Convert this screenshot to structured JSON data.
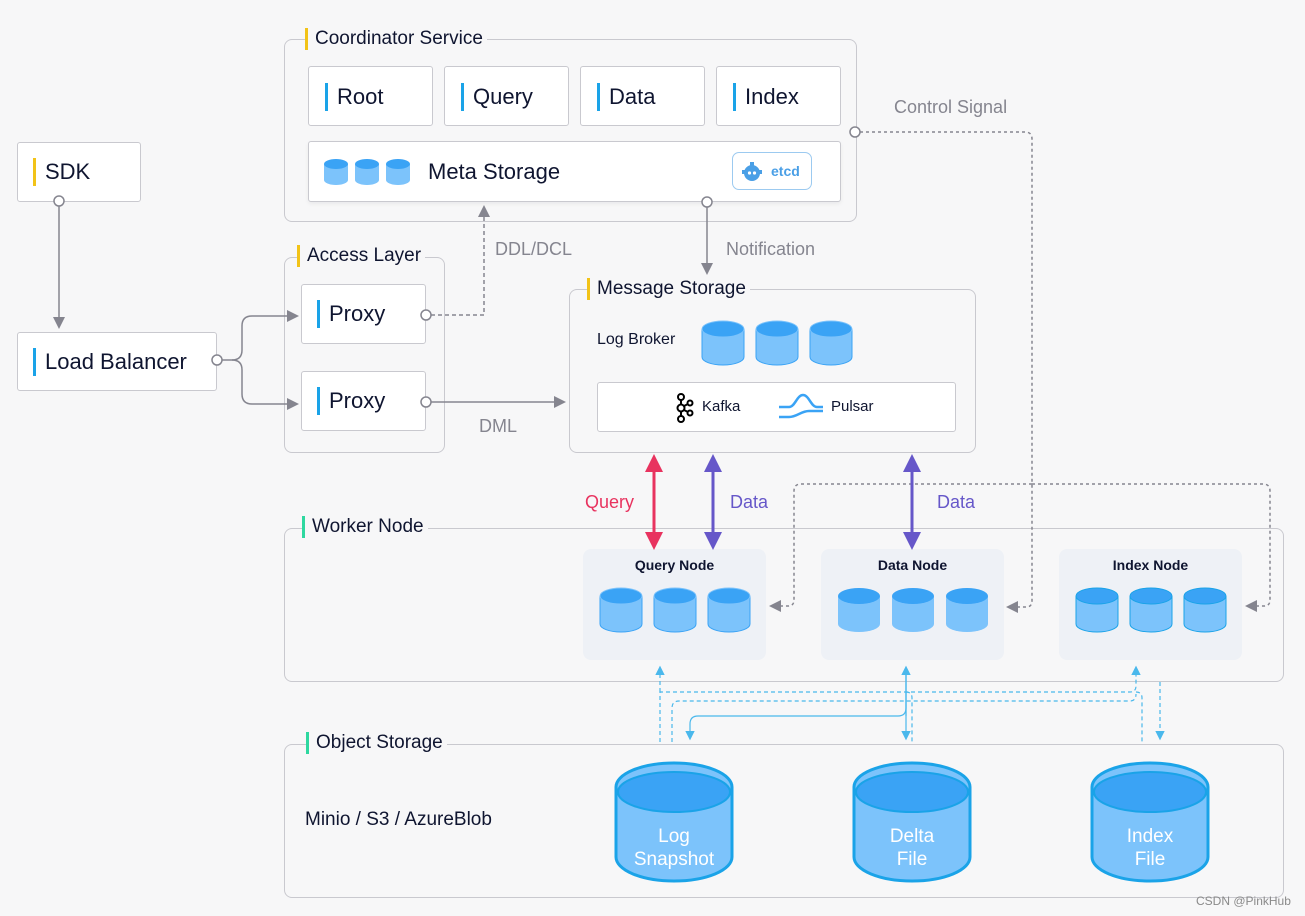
{
  "coordinator": {
    "title": "Coordinator Service",
    "components": [
      "Root",
      "Query",
      "Data",
      "Index"
    ],
    "meta_storage": {
      "label": "Meta Storage",
      "badge": "etcd",
      "badge_icon": "etcd-icon"
    }
  },
  "sdk": {
    "label": "SDK"
  },
  "load_balancer": {
    "label": "Load Balancer"
  },
  "access_layer": {
    "title": "Access Layer",
    "proxies": [
      "Proxy",
      "Proxy"
    ]
  },
  "message_storage": {
    "title": "Message Storage",
    "log_broker": "Log Broker",
    "backends": [
      {
        "name": "Kafka",
        "icon": "kafka-icon"
      },
      {
        "name": "Pulsar",
        "icon": "pulsar-icon"
      }
    ]
  },
  "edges": {
    "control_signal": "Control Signal",
    "ddl_dcl": "DDL/DCL",
    "notification": "Notification",
    "dml": "DML",
    "query": "Query",
    "data_left": "Data",
    "data_right": "Data"
  },
  "worker_node": {
    "title": "Worker Node",
    "nodes": [
      "Query Node",
      "Data Node",
      "Index Node"
    ]
  },
  "object_storage": {
    "title": "Object Storage",
    "providers": "Minio / S3 / AzureBlob",
    "stores": [
      {
        "line1": "Log",
        "line2": "Snapshot"
      },
      {
        "line1": "Delta",
        "line2": "File"
      },
      {
        "line1": "Index",
        "line2": "File"
      }
    ]
  },
  "colors": {
    "yellow_bar": "#f2c318",
    "blue_bar": "#1aa3e8",
    "green_bar": "#2ed8a0",
    "query_arrow": "#e8335f",
    "data_arrow": "#6657c9",
    "edge_gray": "#85858f",
    "storage_blue": "#3aa3f5"
  },
  "watermark": "CSDN @PinkHub"
}
